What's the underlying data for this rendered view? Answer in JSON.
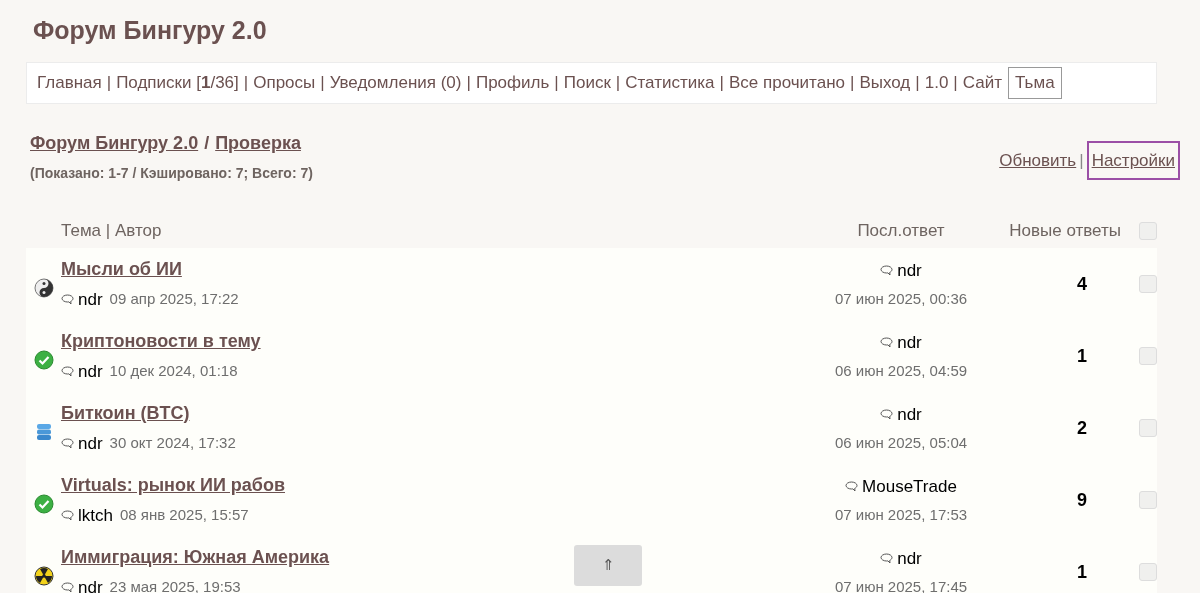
{
  "title": "Форум Бингуру 2.0",
  "nav": {
    "separator": "|",
    "items": [
      {
        "label": "Главная"
      },
      {
        "label": "Подписки [**1**/36]"
      },
      {
        "label": "Опросы"
      },
      {
        "label": "Уведомления (0)"
      },
      {
        "label": "Профиль"
      },
      {
        "label": "Поиск"
      },
      {
        "label": "Статистика"
      },
      {
        "label": "Все прочитано"
      },
      {
        "label": "Выход"
      },
      {
        "label": "1.0"
      },
      {
        "label": "Сайт"
      }
    ],
    "theme_button": "Тьма"
  },
  "breadcrumb": {
    "items": [
      "Форум Бингуру 2.0",
      "Проверка"
    ],
    "separator": "/"
  },
  "counts": "(Показано: 1-7 / Кэшировано: 7; Всего: 7)",
  "actions": {
    "refresh": "Обновить",
    "separator": "|",
    "settings": "Настройки"
  },
  "table": {
    "columns": [
      "Тема | Автор",
      "Посл.ответ",
      "Новые ответы"
    ],
    "select_all_checked": false,
    "rows": [
      {
        "kind": "yinyang",
        "title": "Мысли об ИИ",
        "author": "ndr",
        "date": "09 апр 2025, 17:22",
        "last_author": "ndr",
        "last_date": "07 июн 2025, 00:36",
        "new": "4",
        "checked": false
      },
      {
        "kind": "check",
        "title": "Криптоновости в тему",
        "author": "ndr",
        "date": "10 дек 2024, 01:18",
        "last_author": "ndr",
        "last_date": "06 июн 2025, 04:59",
        "new": "1",
        "checked": false
      },
      {
        "kind": "database",
        "title": "Биткоин (BTC)",
        "author": "ndr",
        "date": "30 окт 2024, 17:32",
        "last_author": "ndr",
        "last_date": "06 июн 2025, 05:04",
        "new": "2",
        "checked": false
      },
      {
        "kind": "check",
        "title": "Virtuals: рынок ИИ рабов",
        "author": "lktch",
        "date": "08 янв 2025, 15:57",
        "last_author": "MouseTrade",
        "last_date": "07 июн 2025, 17:53",
        "new": "9",
        "checked": false
      },
      {
        "kind": "radiation",
        "title": "Иммиграция: Южная Америка",
        "author": "ndr",
        "date": "23 мая 2025, 19:53",
        "last_author": "ndr",
        "last_date": "07 июн 2025, 17:45",
        "new": "1",
        "checked": false
      }
    ]
  },
  "scroll_top": "⇑"
}
